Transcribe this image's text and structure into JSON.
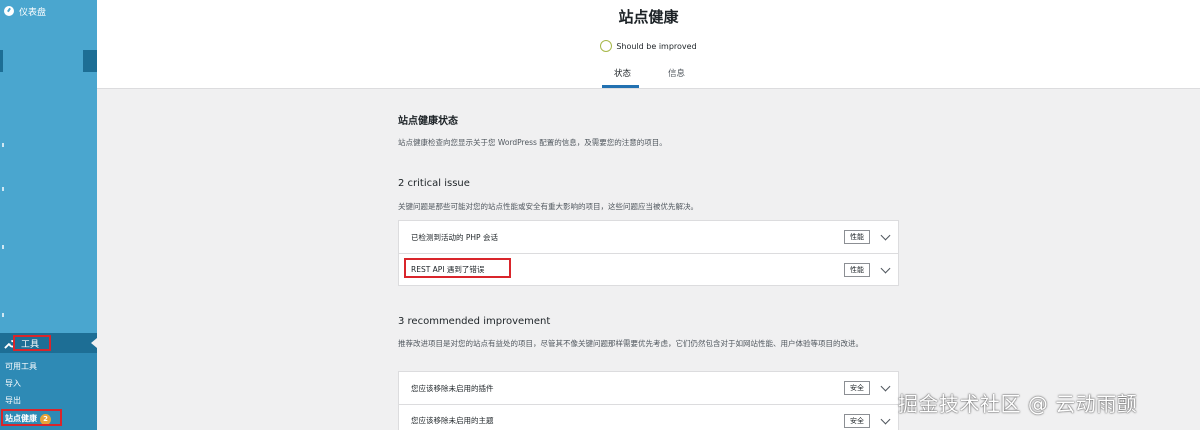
{
  "sidebar": {
    "dashboard_label": "仪表盘",
    "tools_label": "工具",
    "submenu": [
      "可用工具",
      "导入",
      "导出",
      "站点健康"
    ],
    "site_health_badge": "2"
  },
  "header": {
    "title": "站点健康",
    "status_text": "Should be improved",
    "tabs": [
      "状态",
      "信息"
    ]
  },
  "main": {
    "section_title": "站点健康状态",
    "section_desc": "站点健康检查向您显示关于您 WordPress 配置的信息，及需要您的注意的项目。",
    "critical_title": "2 critical issue",
    "critical_desc": "关键问题是那些可能对您的站点性能或安全有重大影响的项目，这些问题应当被优先解决。",
    "critical_items": [
      {
        "label": "已检测到活动的 PHP 会话",
        "tag": "性能"
      },
      {
        "label": "REST API 遇到了错误",
        "tag": "性能"
      }
    ],
    "recommended_title": "3 recommended improvement",
    "recommended_desc": "推荐改进项目是对您的站点有益处的项目，尽管其不像关键问题那样需要优先考虑，它们仍然包含对于如网站性能、用户体验等项目的改进。",
    "recommended_items": [
      {
        "label": "您应该移除未启用的插件",
        "tag": "安全"
      },
      {
        "label": "您应该移除未启用的主题",
        "tag": "安全"
      }
    ]
  },
  "watermark": "掘金技术社区 @ 云动雨颤",
  "colors": {
    "sidebar": "#4aa6cf",
    "sidebar_active": "#1d6e95",
    "accent": "#2271b1",
    "highlight_border": "#d9252b",
    "status_circle": "#a7b84a"
  }
}
